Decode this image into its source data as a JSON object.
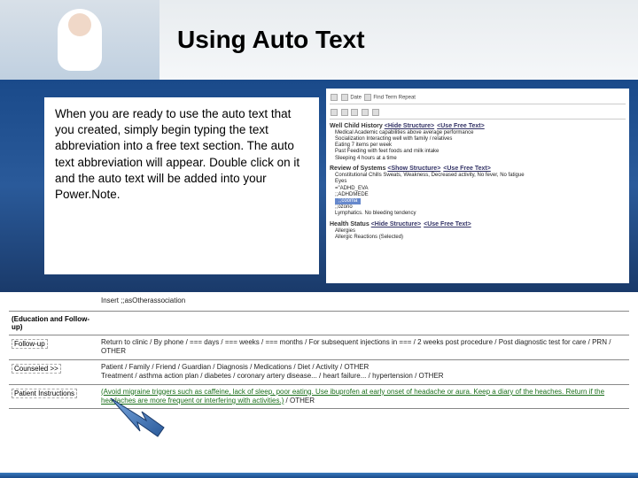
{
  "title": "Using Auto Text",
  "body_text": "When you are ready to use the auto text that you created, simply begin typing the text abbreviation into a free text section. The auto text abbreviation will appear. Double click on it and the auto text will be added into your Power.Note.",
  "ehr": {
    "toolbar_items": [
      "Date",
      "Find Term",
      "Repeat"
    ],
    "section1_title": "Well Child History",
    "section1_tabs": [
      "<Hide Structure>",
      "<Use Free Text>"
    ],
    "section1_items": [
      "Medical Academic capabilities above average performance",
      "Socialization Interacting well with family / relatives",
      "Eating 7 items per week",
      "Past Feeding with feet foods and milk intake",
      "Sleeping 4 hours at a time"
    ],
    "section2_title": "Review of Systems",
    "section2_tabs": [
      "<Show Structure>",
      "<Use Free Text>"
    ],
    "section2_items": [
      "Constitutional Chills Sweats, Weakness, Decreased activity, No fever, No fatigue",
      "Eyes",
      "=\"ADHD_EVA",
      ";;ADHDMEDE",
      ";;cooma",
      ";;ozono",
      "Lymphatics. No bleeding tendency"
    ],
    "highlight": ";;cooma",
    "section3_title": "Health Status",
    "section3_tabs": [
      "<Hide Structure>",
      "<Use Free Text>"
    ],
    "section3_items": [
      "Allergies",
      "Allergic Reactions (Selected)"
    ]
  },
  "lower": {
    "row0_label": "",
    "row0_content": "Insert ;;asOtherassociation",
    "row1_label": "(Education and Follow-up)",
    "row2_label": "Follow-up",
    "row2_content": "Return to clinic / By phone / === days / === weeks / === months / For subsequent injections in === / 2 weeks post procedure / Post diagnostic test for care / PRN / OTHER",
    "row3_label": "Counseled >>",
    "row3_content": "Patient / Family / Friend / Guardian / Diagnosis / Medications / Diet / Activity / OTHER",
    "row3_content2": "Treatment / asthma action plan / diabetes / coronary artery disease... / heart failure... / hypertension / OTHER",
    "row4_label": "Patient Instructions",
    "row4_green": "(Avoid migraine triggers such as caffeine, lack of sleep, poor eating. Use ibuprofen at early onset of headache or aura. Keep a diary of the heaches. Return if the headaches are more frequent or interfering with activities.)",
    "row4_suffix": " / OTHER"
  }
}
